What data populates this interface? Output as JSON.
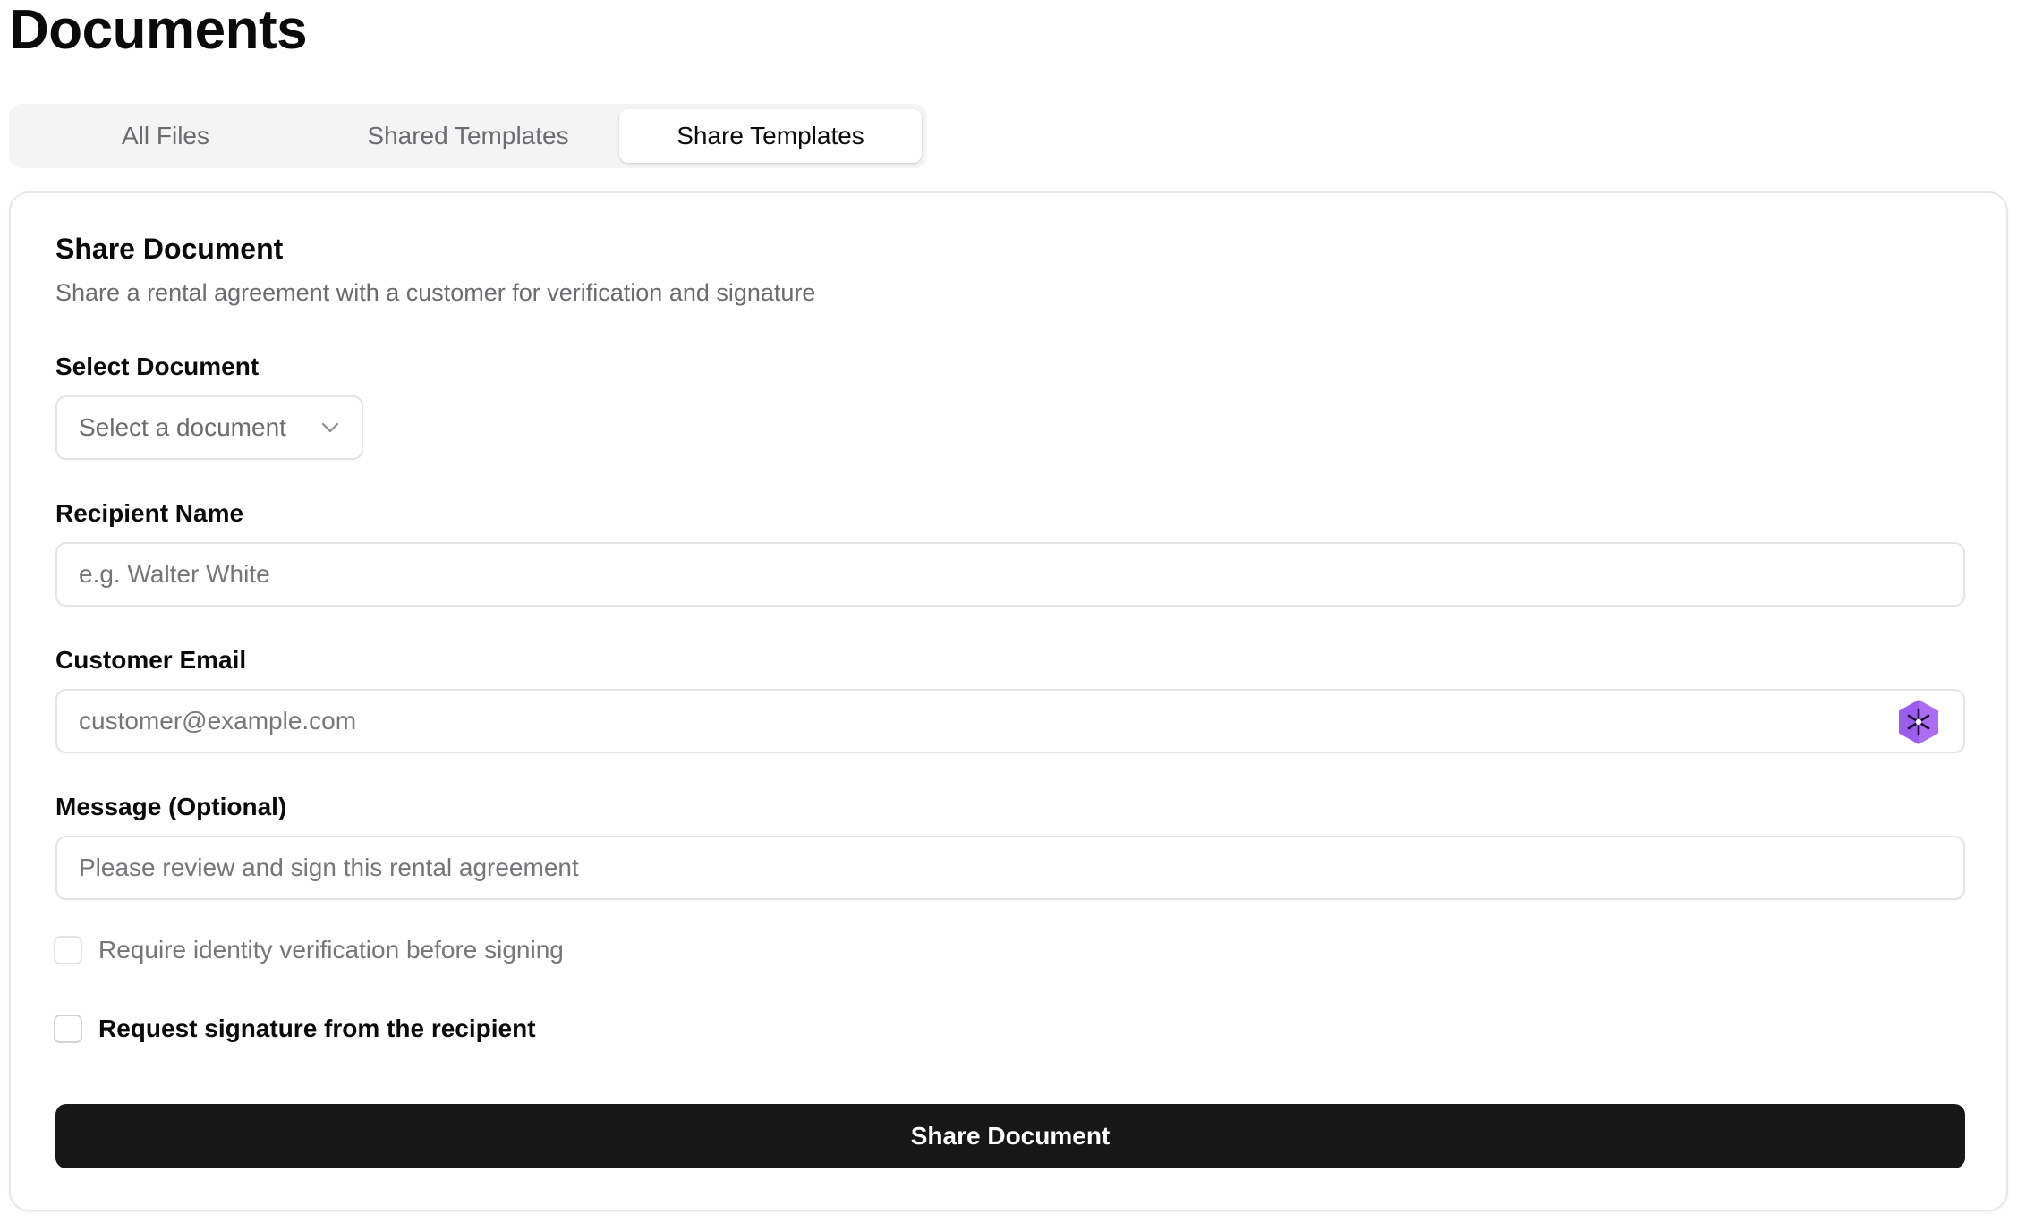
{
  "header": {
    "title": "Documents"
  },
  "tabs": [
    {
      "label": "All Files",
      "active": false
    },
    {
      "label": "Shared Templates",
      "active": false
    },
    {
      "label": "Share Templates",
      "active": true
    }
  ],
  "card": {
    "title": "Share Document",
    "description": "Share a rental agreement with a customer for verification and signature"
  },
  "form": {
    "select_document": {
      "label": "Select Document",
      "placeholder": "Select a document",
      "icon": "chevron-down-icon"
    },
    "recipient_name": {
      "label": "Recipient Name",
      "placeholder": "e.g. Walter White"
    },
    "customer_email": {
      "label": "Customer Email",
      "placeholder": "customer@example.com",
      "extension_icon": "sparkle-hexagon-icon",
      "extension_icon_color": "#9b5cf0"
    },
    "message": {
      "label": "Message (Optional)",
      "placeholder": "Please review and sign this rental agreement"
    },
    "require_identity": {
      "label": "Require identity verification before signing",
      "checked": false,
      "disabled": true
    },
    "request_signature": {
      "label": "Request signature from the recipient",
      "checked": false,
      "disabled": false
    },
    "submit_label": "Share Document"
  },
  "colors": {
    "primary_button": "#171717",
    "tab_track": "#f4f4f5",
    "muted_text": "#6b6b70",
    "border": "#e4e4e7"
  }
}
